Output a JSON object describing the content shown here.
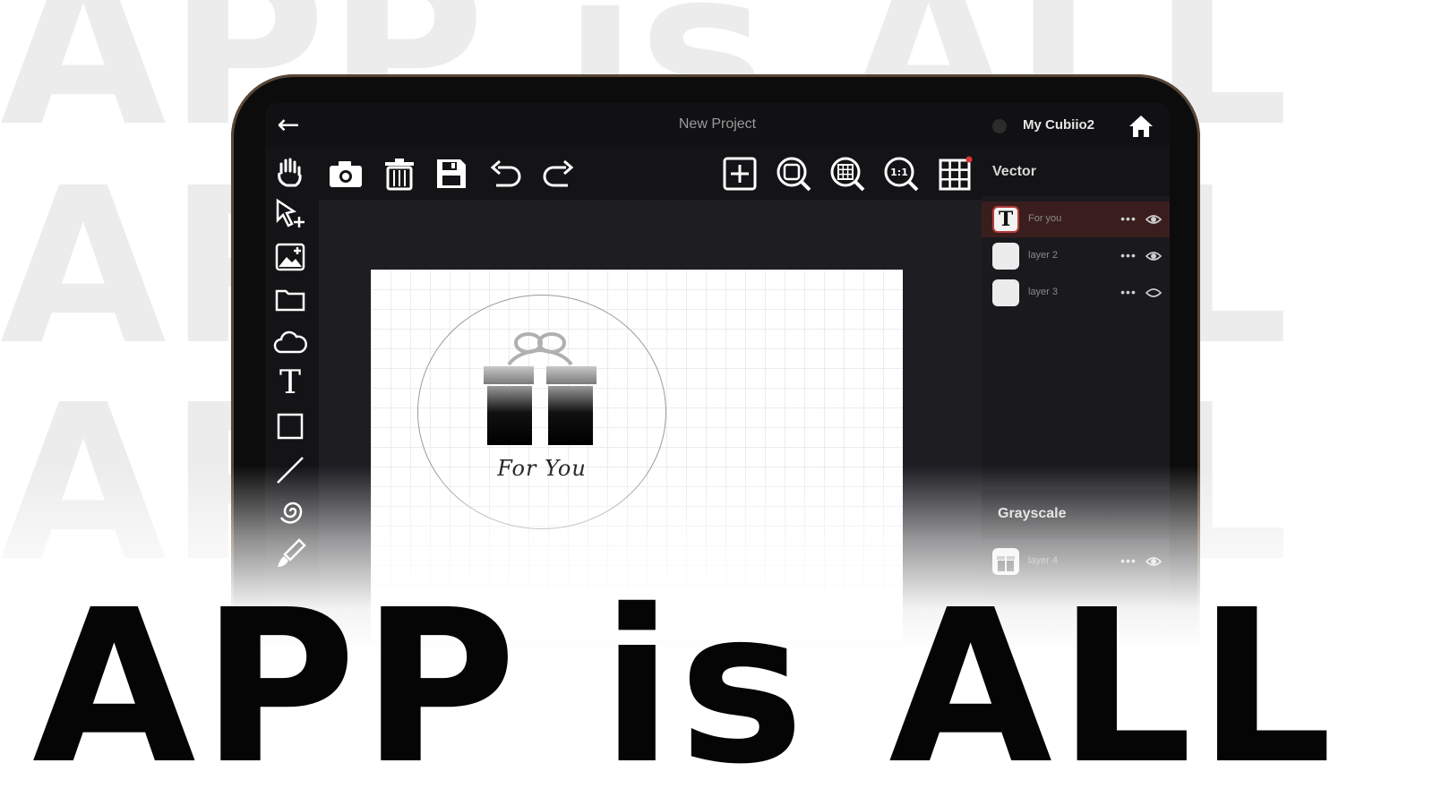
{
  "background_words": [
    "APP is ALL",
    "APP is ALL",
    "APP is ALL"
  ],
  "headline": "APP is ALL",
  "app": {
    "title": "New Project",
    "device_name": "My Cubiio2",
    "back_icon": "back-arrow-icon",
    "home_icon": "home-icon"
  },
  "toolbar": {
    "left_icons": [
      "camera-icon",
      "trash-icon",
      "save-icon",
      "undo-icon",
      "redo-icon"
    ],
    "right_icons": [
      "add-icon",
      "zoom-fit-icon",
      "zoom-grid-icon",
      "zoom-1to1-icon",
      "grid-toggle-icon"
    ],
    "zoom_1to1_label": "1:1"
  },
  "left_tools": [
    "hand-icon",
    "select-add-icon",
    "image-add-icon",
    "folder-icon",
    "cloud-icon",
    "text-tool-icon",
    "rectangle-icon",
    "line-icon",
    "spiral-icon",
    "brush-icon"
  ],
  "text_tool_glyph": "T",
  "canvas": {
    "design_text": "For You",
    "design_icon": "gift-icon"
  },
  "layers_panel": {
    "vector_heading": "Vector",
    "vector_layers": [
      {
        "name": "For you",
        "thumb": "T",
        "active": true,
        "visible": true
      },
      {
        "name": "layer 2",
        "thumb": "",
        "active": false,
        "visible": true
      },
      {
        "name": "layer 3",
        "thumb": "",
        "active": false,
        "visible": false
      }
    ],
    "grayscale_heading": "Grayscale",
    "grayscale_layers": [
      {
        "name": "layer 4",
        "thumb": "gift",
        "active": false,
        "visible": true
      }
    ],
    "more_label": "•••"
  },
  "colors": {
    "accent_active_layer": "#3a1e1e",
    "accent_text_thumb_border": "#b53b3b",
    "screen_bg": "#1d1d22",
    "tablet_bezel": "#0c0c0c"
  }
}
